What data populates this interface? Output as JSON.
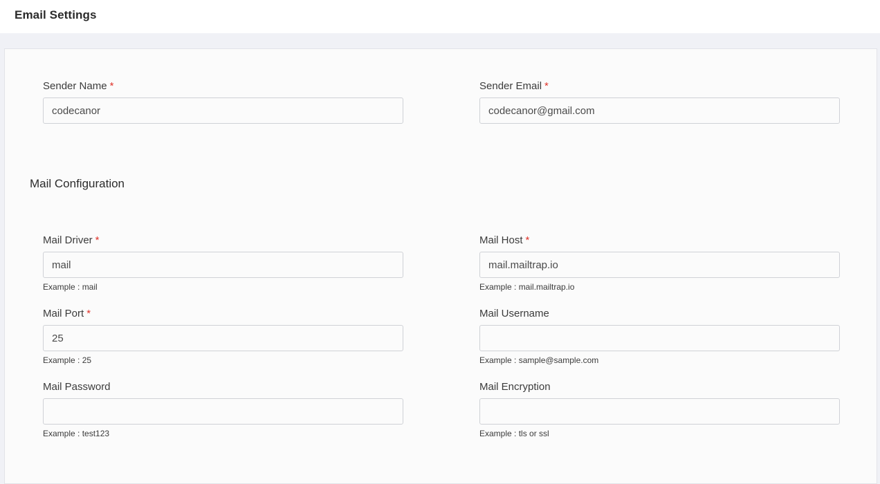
{
  "header": {
    "title": "Email Settings"
  },
  "sender": {
    "name": {
      "label": "Sender Name",
      "required_mark": "*",
      "value": "codecanor"
    },
    "email": {
      "label": "Sender Email",
      "required_mark": "*",
      "value": "codecanor@gmail.com"
    }
  },
  "mail_config": {
    "section_title": "Mail Configuration",
    "driver": {
      "label": "Mail Driver",
      "required_mark": "*",
      "value": "mail",
      "hint": "Example : mail"
    },
    "host": {
      "label": "Mail Host",
      "required_mark": "*",
      "value": "mail.mailtrap.io",
      "hint": "Example : mail.mailtrap.io"
    },
    "port": {
      "label": "Mail Port",
      "required_mark": "*",
      "value": "25",
      "hint": "Example : 25"
    },
    "username": {
      "label": "Mail Username",
      "value": "",
      "hint": "Example : sample@sample.com"
    },
    "password": {
      "label": "Mail Password",
      "value": "",
      "hint": "Example : test123"
    },
    "encryption": {
      "label": "Mail Encryption",
      "value": "",
      "hint": "Example : tls or ssl"
    }
  },
  "colors": {
    "required": "#e0342b",
    "page_bg": "#f0f1f6",
    "card_bg": "#fbfbfb",
    "input_border": "#cfd1d6"
  }
}
